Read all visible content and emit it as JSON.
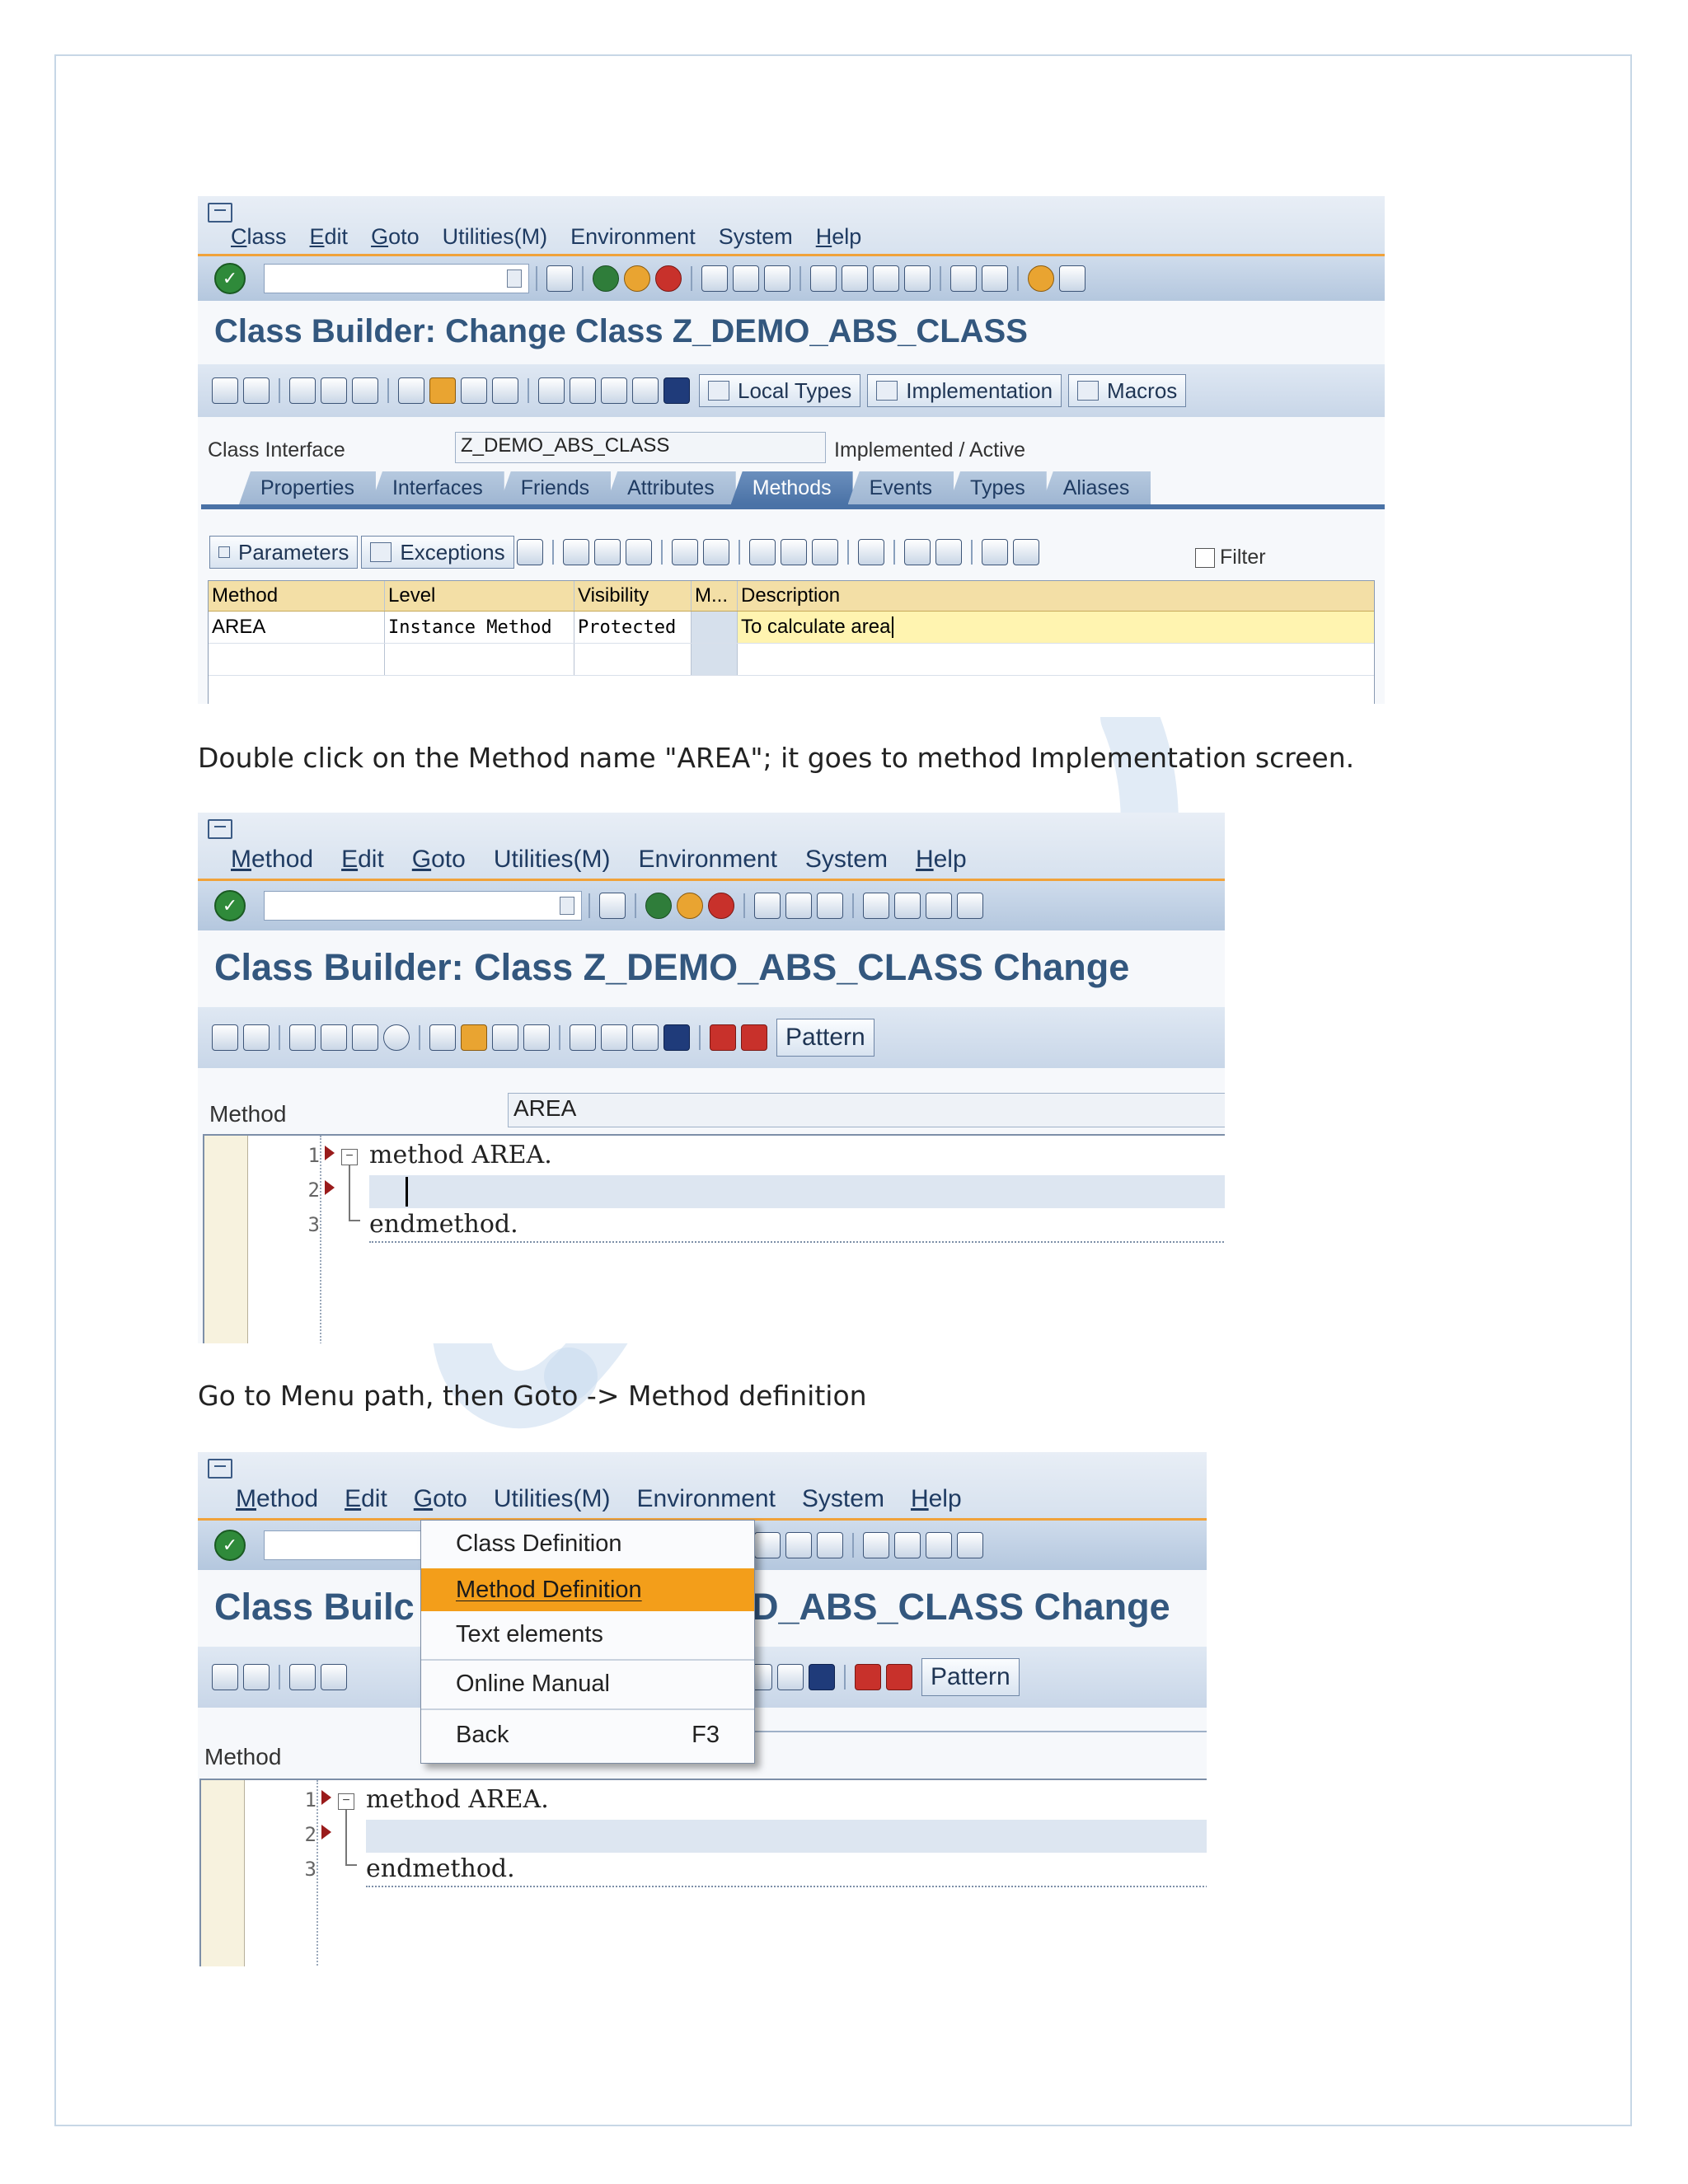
{
  "screen1": {
    "menu": [
      "Class",
      "Edit",
      "Goto",
      "Utilities(M)",
      "Environment",
      "System",
      "Help"
    ],
    "title": "Class Builder: Change Class Z_DEMO_ABS_CLASS",
    "app_buttons": [
      "Local Types",
      "Implementation",
      "Macros"
    ],
    "class_interface_label": "Class Interface",
    "class_interface_value": "Z_DEMO_ABS_CLASS",
    "class_status": "Implemented / Active",
    "tabs": [
      "Properties",
      "Interfaces",
      "Friends",
      "Attributes",
      "Methods",
      "Events",
      "Types",
      "Aliases"
    ],
    "active_tab": "Methods",
    "toolbar_buttons": [
      "Parameters",
      "Exceptions"
    ],
    "filter_label": "Filter",
    "columns": [
      "Method",
      "Level",
      "Visibility",
      "M...",
      "Description"
    ],
    "rows": [
      {
        "method": "AREA",
        "level": "Instance Method",
        "visibility": "Protected",
        "m": "",
        "description": "To calculate area"
      }
    ]
  },
  "caption1": "Double click on the Method name \"AREA\"; it goes to method Implementation screen.",
  "screen2": {
    "menu": [
      "Method",
      "Edit",
      "Goto",
      "Utilities(M)",
      "Environment",
      "System",
      "Help"
    ],
    "title": "Class Builder: Class Z_DEMO_ABS_CLASS Change",
    "pattern_button": "Pattern",
    "method_label": "Method",
    "method_value": "AREA",
    "code_lines": [
      {
        "num": "1",
        "text": "method AREA."
      },
      {
        "num": "2",
        "text": ""
      },
      {
        "num": "3",
        "text": "endmethod."
      }
    ]
  },
  "caption2": "Go to Menu path, then Goto -> Method definition",
  "screen3": {
    "menu": [
      "Method",
      "Edit",
      "Goto",
      "Utilities(M)",
      "Environment",
      "System",
      "Help"
    ],
    "title_left": "Class Builc",
    "title_right": "D_ABS_CLASS Change",
    "pattern_button": "Pattern",
    "method_label": "Method",
    "goto_menu": [
      {
        "label": "Class Definition",
        "shortcut": ""
      },
      {
        "label": "Method Definition",
        "shortcut": ""
      },
      {
        "label": "Text elements",
        "shortcut": ""
      },
      {
        "label": "Online Manual",
        "shortcut": ""
      },
      {
        "label": "Back",
        "shortcut": "F3"
      }
    ],
    "highlighted_item": "Method Definition",
    "code_lines": [
      {
        "num": "1",
        "text": "method AREA."
      },
      {
        "num": "2",
        "text": ""
      },
      {
        "num": "3",
        "text": "endmethod."
      }
    ]
  },
  "colors": {
    "accent_orange": "#f39e1a",
    "title_blue": "#33577e",
    "grid_header": "#f3dfa6",
    "frame_border": "#c7d7e6"
  }
}
